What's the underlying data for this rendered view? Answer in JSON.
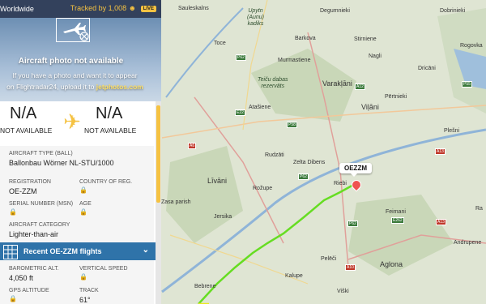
{
  "topbar": {
    "region": "Worldwide",
    "tracked": "Tracked by 1,008",
    "live": "LIVE"
  },
  "photo": {
    "title": "Aircraft photo not available",
    "line1": "If you have a photo and want it to appear",
    "line2": "on Flightradar24, upload it to",
    "link": "jetphotos.com"
  },
  "route": {
    "origin_code": "N/A",
    "origin_sub": "NOT AVAILABLE",
    "dest_code": "N/A",
    "dest_sub": "NOT AVAILABLE"
  },
  "details": {
    "type_label": "AIRCRAFT TYPE (BALL)",
    "type_value": "Ballonbau Wörner NL-STU/1000",
    "reg_label": "REGISTRATION",
    "reg_value": "OE-ZZM",
    "country_label": "COUNTRY OF REG.",
    "serial_label": "SERIAL NUMBER (MSN)",
    "age_label": "AGE",
    "category_label": "AIRCRAFT CATEGORY",
    "category_value": "Lighter-than-air",
    "recent_label": "Recent OE-ZZM flights",
    "baro_label": "BAROMETRIC ALT.",
    "baro_value": "4,050 ft",
    "vspeed_label": "VERTICAL SPEED",
    "gps_label": "GPS ALTITUDE",
    "track_label": "TRACK",
    "track_value": "61°"
  },
  "map": {
    "callout": "OEZZM",
    "labels": {
      "sauleskalns": "Sauleskalns",
      "degumnieki": "Degumnieki",
      "dobrinieki": "Dobrinieki",
      "kadiks": "Upytn\n(Aunu)\nkadiks",
      "toce": "Toce",
      "barkova": "Barkova",
      "murmastiene": "Murmastiene",
      "stirniene": "Stirniene",
      "nagli": "Nagli",
      "rogovka": "Rogovka",
      "dricani": "Dricāni",
      "varakljani": "Varakļāni",
      "teicu": "Teiču dabas\nrezervāts",
      "atasiene": "Atašiene",
      "pertnieki": "Pērtnieki",
      "vilani": "Viļāni",
      "plesni": "Plešni",
      "rudzati": "Rudzāti",
      "zelta": "Zelta Dibens",
      "livani": "Līvāni",
      "rozupe": "Rožupe",
      "riebini": "Riebi",
      "parish": "Zasa parish",
      "jersika": "Jersika",
      "feimani": "Feimani",
      "andrupene": "Andrupene",
      "peleci": "Pelēči",
      "aglona": "Aglona",
      "kalupe": "Kalupe",
      "bebrene": "Bebrene",
      "viski": "Viški",
      "ra": "Ra"
    },
    "shields": {
      "p62a": "P62",
      "p62b": "P62",
      "a12": "A12",
      "p58": "P58",
      "p55": "P55",
      "a6": "A6",
      "p62c": "P62",
      "a13": "A13",
      "e22": "E22",
      "a10": "A10",
      "e262": "E262",
      "a13b": "A13"
    }
  },
  "colors": {
    "track": "#66dd22",
    "accent": "#f5c242",
    "panel_header": "#33415c",
    "recent_bar": "#2f73a9"
  }
}
